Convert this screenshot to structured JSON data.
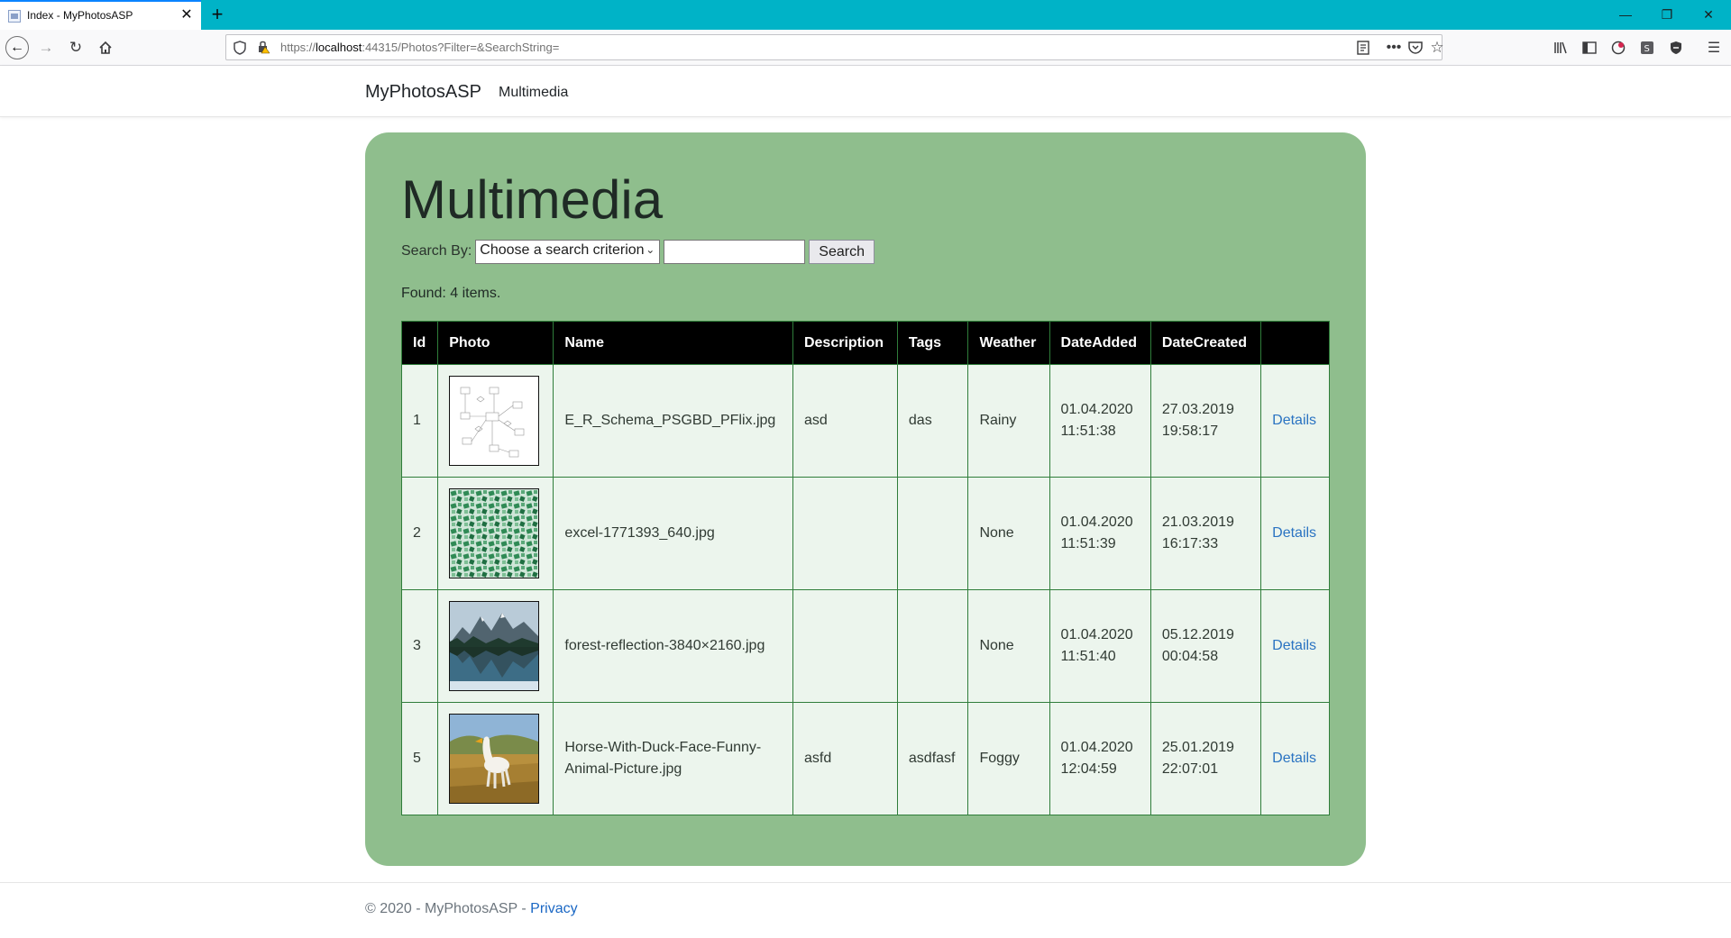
{
  "browser": {
    "tab_title": "Index - MyPhotosASP",
    "url_prefix": "https://",
    "url_host": "localhost",
    "url_rest": ":44315/Photos?Filter=&SearchString="
  },
  "site": {
    "brand": "MyPhotosASP",
    "nav_link": "Multimedia"
  },
  "page": {
    "title": "Multimedia",
    "search_label": "Search By:",
    "select_value": "Choose a search criterion",
    "search_value": "",
    "search_button": "Search",
    "found_text": "Found: 4 items."
  },
  "table": {
    "headers": [
      "Id",
      "Photo",
      "Name",
      "Description",
      "Tags",
      "Weather",
      "DateAdded",
      "DateCreated",
      ""
    ],
    "rows": [
      {
        "id": "1",
        "name": "E_R_Schema_PSGBD_PFlix.jpg",
        "description": "asd",
        "tags": "das",
        "weather": "Rainy",
        "date_added_1": "01.04.2020",
        "date_added_2": "11:51:38",
        "date_created_1": "27.03.2019",
        "date_created_2": "19:58:17",
        "link": "Details"
      },
      {
        "id": "2",
        "name": "excel-1771393_640.jpg",
        "description": "",
        "tags": "",
        "weather": "None",
        "date_added_1": "01.04.2020",
        "date_added_2": "11:51:39",
        "date_created_1": "21.03.2019",
        "date_created_2": "16:17:33",
        "link": "Details"
      },
      {
        "id": "3",
        "name": "forest-reflection-3840×2160.jpg",
        "description": "",
        "tags": "",
        "weather": "None",
        "date_added_1": "01.04.2020",
        "date_added_2": "11:51:40",
        "date_created_1": "05.12.2019",
        "date_created_2": "00:04:58",
        "link": "Details"
      },
      {
        "id": "5",
        "name_1": "Horse-With-Duck-Face-Funny-",
        "name_2": "Animal-Picture.jpg",
        "description": "asfd",
        "tags": "asdfasf",
        "weather": "Foggy",
        "date_added_1": "01.04.2020",
        "date_added_2": "12:04:59",
        "date_created_1": "25.01.2019",
        "date_created_2": "22:07:01",
        "link": "Details"
      }
    ]
  },
  "footer": {
    "text": "© 2020 - MyPhotosASP - ",
    "privacy": "Privacy"
  }
}
